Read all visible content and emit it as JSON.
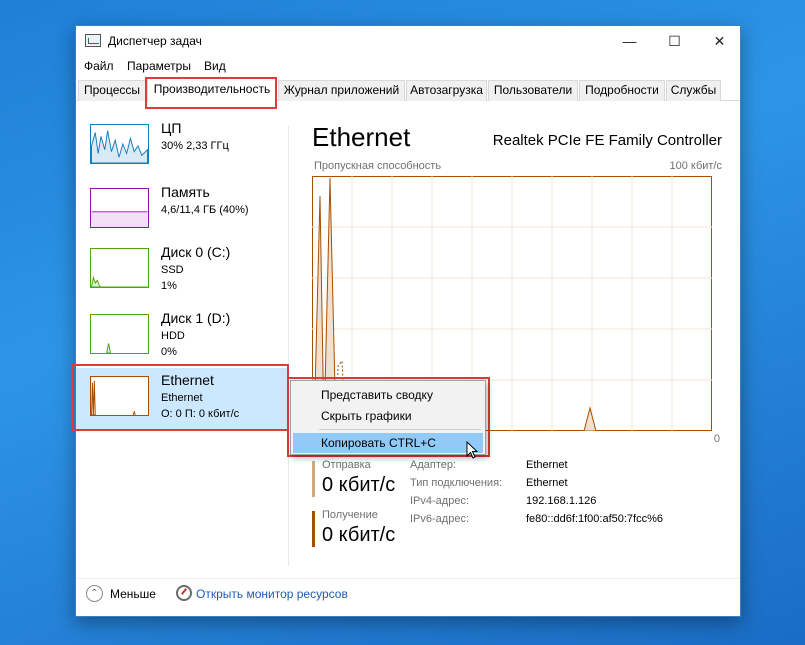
{
  "window": {
    "title": "Диспетчер задач"
  },
  "menu": [
    "Файл",
    "Параметры",
    "Вид"
  ],
  "tabs": [
    "Процессы",
    "Производительность",
    "Журнал приложений",
    "Автозагрузка",
    "Пользователи",
    "Подробности",
    "Службы"
  ],
  "active_tab": "Производительность",
  "sidebar": {
    "items": [
      {
        "title": "ЦП",
        "sub1": "30% 2,33 ГГц",
        "sub2": "",
        "color": "#117dbb",
        "icon": "cpu-graph-icon"
      },
      {
        "title": "Память",
        "sub1": "4,6/11,4 ГБ (40%)",
        "sub2": "",
        "color": "#8b12ae",
        "icon": "memory-graph-icon"
      },
      {
        "title": "Диск 0 (C:)",
        "sub1": "SSD",
        "sub2": "1%",
        "color": "#4da60c",
        "icon": "disk-graph-icon"
      },
      {
        "title": "Диск 1 (D:)",
        "sub1": "HDD",
        "sub2": "0%",
        "color": "#4da60c",
        "icon": "disk-graph-icon"
      },
      {
        "title": "Ethernet",
        "sub1": "Ethernet",
        "sub2": "О: 0 П: 0 кбит/с",
        "color": "#a74f01",
        "icon": "network-graph-icon"
      }
    ],
    "selected": "Ethernet"
  },
  "main": {
    "title": "Ethernet",
    "device": "Realtek PCIe FE Family Controller",
    "graph_label": "Пропускная способность",
    "graph_max": "100 кбит/с",
    "graph_min": "0",
    "send_label": "Отправка",
    "send_value": "0 кбит/с",
    "recv_label": "Получение",
    "recv_value": "0 кбит/с",
    "info": [
      {
        "label": "Адаптер:",
        "value": "Ethernet"
      },
      {
        "label": "Тип подключения:",
        "value": "Ethernet"
      },
      {
        "label": "IPv4-адрес:",
        "value": "192.168.1.126"
      },
      {
        "label": "IPv6-адрес:",
        "value": "fe80::dd6f:1f00:af50:7fcc%6"
      }
    ]
  },
  "context_menu": {
    "items": [
      "Представить сводку",
      "Скрыть графики",
      "Копировать CTRL+C"
    ],
    "hovered": "Копировать CTRL+C"
  },
  "footer": {
    "fewer": "Меньше",
    "monitor": "Открыть монитор ресурсов"
  },
  "colors": {
    "accent_red": "#e03a3a",
    "network": "#a74f01",
    "selection": "#cce8ff",
    "menu_hover": "#91c9f7",
    "link": "#1a5fb4"
  }
}
